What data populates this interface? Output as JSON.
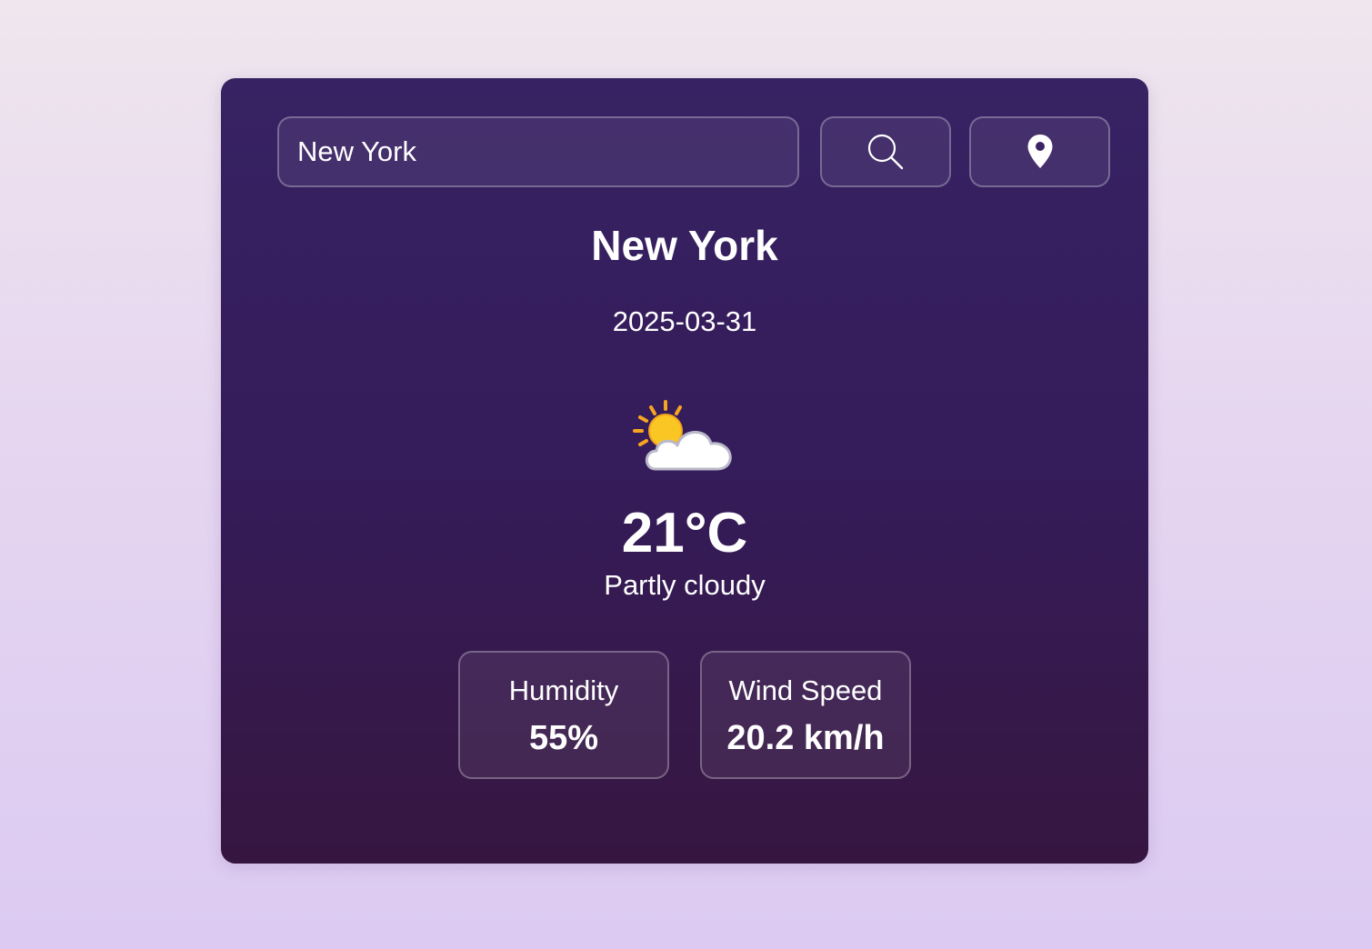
{
  "search": {
    "value": "New York",
    "search_icon": "search-icon",
    "location_icon": "map-pin-icon"
  },
  "weather": {
    "city": "New York",
    "date": "2025-03-31",
    "icon": "partly-cloudy-icon",
    "temperature": "21°C",
    "description": "Partly cloudy"
  },
  "stats": {
    "humidity_label": "Humidity",
    "humidity_value": "55%",
    "wind_label": "Wind Speed",
    "wind_value": "20.2 km/h"
  },
  "colors": {
    "page_background_top": "#efe6ee",
    "page_background_bottom": "#dccaf2",
    "card_top": "#372263",
    "card_bottom": "#361640",
    "text": "#ffffff"
  }
}
